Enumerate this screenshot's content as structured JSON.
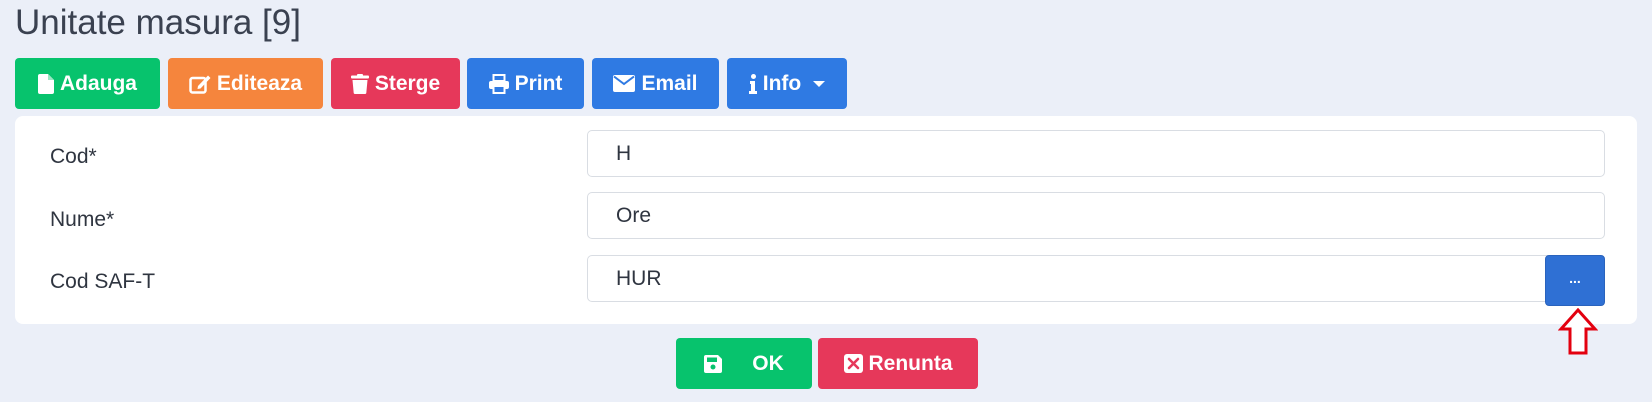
{
  "page": {
    "title": "Unitate masura [9]"
  },
  "toolbar": {
    "add_label": "Adauga",
    "edit_label": "Editeaza",
    "delete_label": "Sterge",
    "print_label": "Print",
    "email_label": "Email",
    "info_label": "Info"
  },
  "form": {
    "cod_label": "Cod*",
    "cod_value": "H",
    "nume_label": "Nume*",
    "nume_value": "Ore",
    "saft_label": "Cod SAF-T",
    "saft_value": "HUR",
    "lookup_label": "..."
  },
  "footer": {
    "ok_label": "OK",
    "cancel_label": "Renunta"
  },
  "colors": {
    "green": "#07c36d",
    "orange": "#f5853d",
    "red": "#e6385a",
    "blue": "#2f7ae3",
    "indicator": "#e3000f",
    "background": "#ebeff8"
  },
  "icons": {
    "add": "file-icon",
    "edit": "edit-icon",
    "delete": "trash-icon",
    "print": "printer-icon",
    "email": "envelope-icon",
    "info": "info-icon",
    "info_caret": "caret-down-icon",
    "ok": "save-icon",
    "cancel": "close-box-icon",
    "indicator": "arrow-up-icon"
  }
}
